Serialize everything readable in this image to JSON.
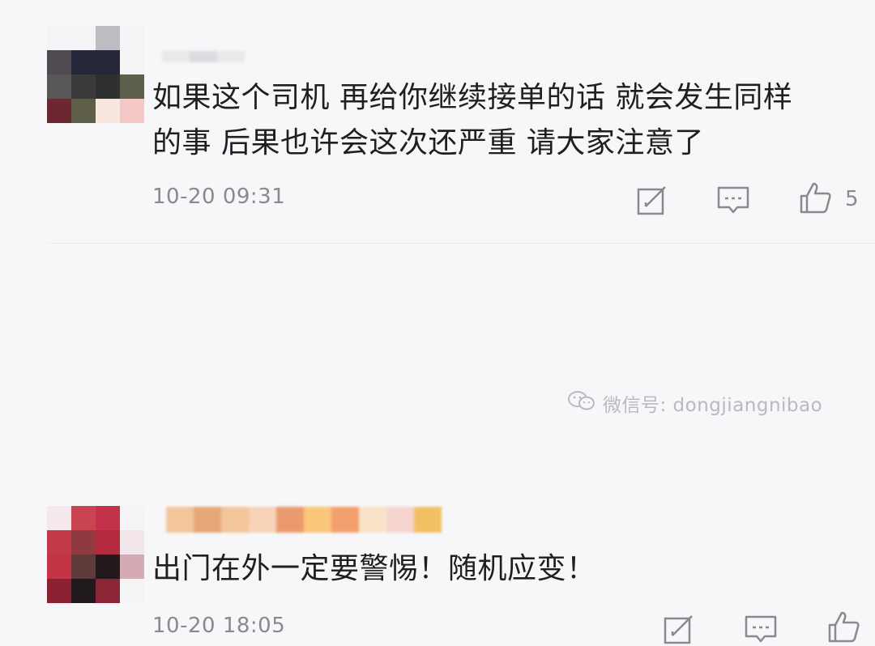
{
  "comments": [
    {
      "text": "如果这个司机 再给你继续接单的话 就会发生同样\n的事 后果也许会这次还严重 请大家注意了",
      "timestamp": "10-20 09:31",
      "like_count": "5",
      "avatar_colors": [
        "#f4f4f6",
        "#f4f4f6",
        "#bcbcc2",
        "#f4f4f6",
        "#4e4a4f",
        "#26263a",
        "#26263a",
        "#f4f4f6",
        "#575757",
        "#3a3a3a",
        "#2f3030",
        "#5c5f49",
        "#6c2733",
        "#5d5d48",
        "#f9e6df",
        "#f5c8c8"
      ],
      "username_colors": [
        "#e9e9ec",
        "#dcdcdf",
        "#e9e9ec"
      ]
    },
    {
      "text": "出门在外一定要警惕！随机应变！",
      "timestamp": "10-20 18:05",
      "like_count": "",
      "avatar_colors": [
        "#f6e9ee",
        "#c94351",
        "#c2334a",
        "#f4f4f6",
        "#c23a4a",
        "#8f3a3f",
        "#b42b3e",
        "#f2e6ea",
        "#c33447",
        "#5e3a3a",
        "#231a1e",
        "#d4aab4",
        "#8b2233",
        "#211a1c",
        "#8a2636",
        "#f4f4f6"
      ],
      "username_colors": [
        "#f3c59a",
        "#e6a779",
        "#f3c59a",
        "#f7d3b8",
        "#ea9a6d",
        "#f9c77a",
        "#f4a06e",
        "#f9e3c8",
        "#f6d4cf",
        "#f0c063"
      ]
    }
  ],
  "watermark": {
    "text": "微信号: dongjiangnibao"
  },
  "icons": {
    "reply": "edit-square-icon",
    "comment": "comment-bubble-icon",
    "like": "thumbs-up-icon",
    "watermark": "wechat-icon"
  }
}
